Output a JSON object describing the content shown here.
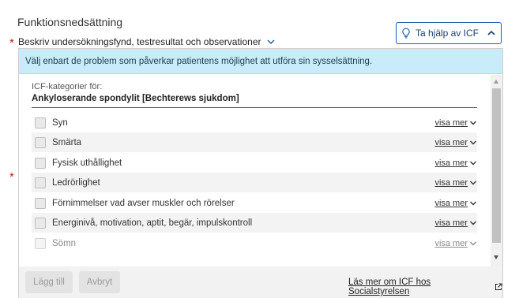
{
  "section": {
    "title": "Funktionsnedsättning",
    "required_marker": "*"
  },
  "description": {
    "label": "Beskriv undersökningsfynd, testresultat och observationer",
    "toggle_icon": "chevron-down-icon"
  },
  "help_button": {
    "label": "Ta hjälp av ICF",
    "icon": "lightbulb-icon",
    "toggle_icon": "chevron-up-icon"
  },
  "panel": {
    "info_text": "Välj enbart de problem som påverkar patientens möjlighet att utföra sin sysselsättning.",
    "category_label": "ICF-kategorier för:",
    "diagnosis": "Ankyloserande spondylit [Bechterews sjukdom]",
    "items": [
      {
        "label": "Syn",
        "more": "visa mer",
        "checked": false,
        "disabled": false
      },
      {
        "label": "Smärta",
        "more": "visa mer",
        "checked": false,
        "disabled": false
      },
      {
        "label": "Fysisk uthållighet",
        "more": "visa mer",
        "checked": false,
        "disabled": false
      },
      {
        "label": "Ledrörlighet",
        "more": "visa mer",
        "checked": false,
        "disabled": false
      },
      {
        "label": "Förnimmelser vad avser muskler och rörelser",
        "more": "visa mer",
        "checked": false,
        "disabled": false
      },
      {
        "label": "Energinivå, motivation, aptit, begär, impulskontroll",
        "more": "visa mer",
        "checked": false,
        "disabled": false
      },
      {
        "label": "Sömn",
        "more": "visa mer",
        "checked": false,
        "disabled": true
      }
    ]
  },
  "footer": {
    "add_label": "Lägg till",
    "cancel_label": "Avbryt",
    "read_more_label": "Läs mer om ICF hos Socialstyrelsen",
    "read_more_icon": "external-link-icon"
  },
  "colors": {
    "banner_bg": "#c8ecfa",
    "accent": "#1b5fa8",
    "required": "#c41c1c"
  }
}
